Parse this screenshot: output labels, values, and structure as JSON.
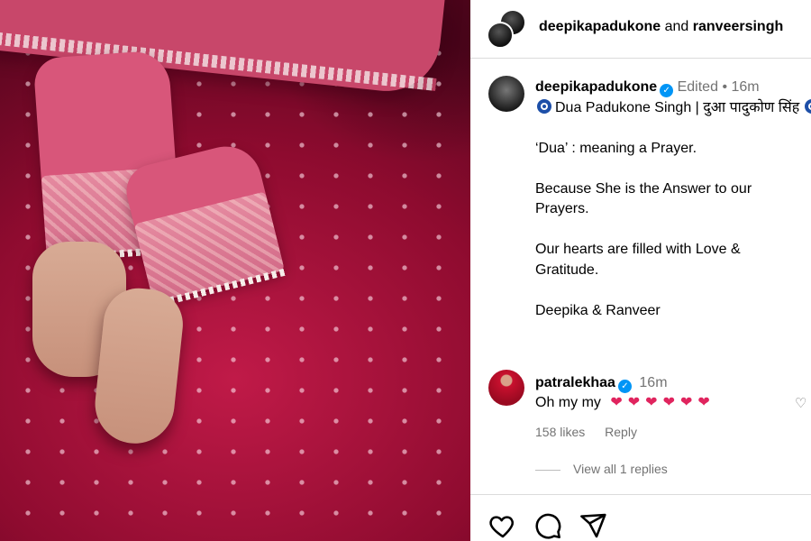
{
  "header": {
    "user1": "deepikapadukone",
    "joiner": "and",
    "user2": "ranveersingh"
  },
  "caption": {
    "username": "deepikapadukone",
    "edited": "Edited",
    "separator": "•",
    "time": "16m",
    "title": "Dua Padukone Singh | दुआ पादुकोण सिंह",
    "lines": [
      "‘Dua’ : meaning a Prayer.",
      "Because She is the Answer to our Prayers.",
      "Our hearts are filled with Love & Gratitude.",
      "Deepika & Ranveer"
    ]
  },
  "comment": {
    "username": "patralekhaa",
    "time": "16m",
    "text": "Oh my my",
    "hearts": [
      "❤",
      "❤",
      "❤",
      "❤",
      "❤",
      "❤"
    ],
    "likes": "158 likes",
    "reply": "Reply",
    "view_replies": "View all 1 replies"
  },
  "actions": [
    "heart-icon",
    "comment-icon",
    "share-icon"
  ],
  "colors": {
    "verified": "#0095f6",
    "heart": "#e0245e",
    "meta": "#737373"
  }
}
